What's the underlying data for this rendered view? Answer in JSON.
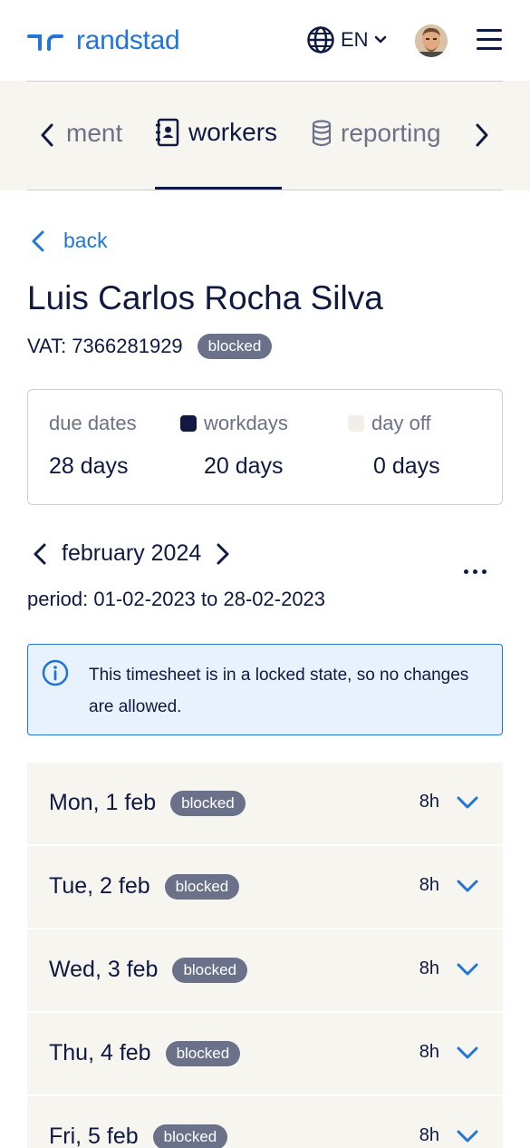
{
  "header": {
    "logo_text": "randstad",
    "language": "EN"
  },
  "tabs": [
    {
      "label": "ment",
      "icon": "none"
    },
    {
      "label": "workers",
      "icon": "contact-book-icon",
      "active": true
    },
    {
      "label": "reporting",
      "icon": "database-icon"
    }
  ],
  "back_label": "back",
  "worker": {
    "name": "Luis Carlos Rocha Silva",
    "vat": "VAT: 7366281929",
    "status": "blocked"
  },
  "stats": [
    {
      "label": "due dates",
      "value": "28 days"
    },
    {
      "label": "workdays",
      "value": "20 days",
      "legend_color": "#0f1941"
    },
    {
      "label": "day off",
      "value": "0 days",
      "legend_color": "#f2efe8"
    }
  ],
  "month": {
    "label": "february 2024",
    "period": "period: 01-02-2023 to 28-02-2023"
  },
  "info_message": "This timesheet is in a locked state, so no changes are allowed.",
  "days": [
    {
      "label": "Mon, 1 feb",
      "status": "blocked",
      "hours": "8h"
    },
    {
      "label": "Tue, 2 feb",
      "status": "blocked",
      "hours": "8h"
    },
    {
      "label": "Wed, 3 feb",
      "status": "blocked",
      "hours": "8h"
    },
    {
      "label": "Thu, 4 feb",
      "status": "blocked",
      "hours": "8h"
    },
    {
      "label": "Fri, 5 feb",
      "status": "blocked",
      "hours": "8h"
    }
  ],
  "colors": {
    "brand_blue": "#2175d9",
    "navy": "#0f1941",
    "badge_grey": "#6b7189",
    "row_bg": "#f7f5f0",
    "info_bg": "#e8f2fc"
  }
}
